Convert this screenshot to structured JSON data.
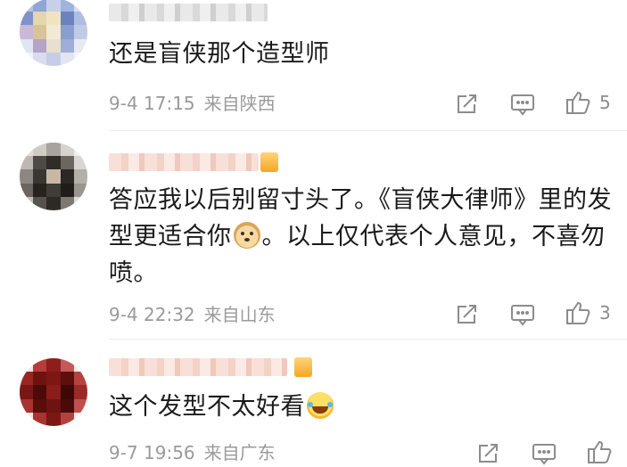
{
  "comments": [
    {
      "text": "还是盲侠那个造型师",
      "text_emoji": "",
      "text_after": "",
      "date": "9-4 17:15",
      "location": "来自陕西",
      "likes": "5"
    },
    {
      "text": "答应我以后别留寸头了。《盲侠大律师》里的发型更适合你",
      "text_emoji": "doge-emoji",
      "text_after": "。以上仅代表个人意见，不喜勿喷。",
      "date": "9-4 22:32",
      "location": "来自山东",
      "likes": "3"
    },
    {
      "text": "这个发型不太好看",
      "text_emoji": "laughing-tears-emoji",
      "text_after": "",
      "date": "9-7 19:56",
      "location": "来自广东",
      "likes": ""
    }
  ],
  "icons": {
    "share": "share-icon",
    "reply": "comment-icon",
    "like": "thumbs-up-icon"
  },
  "colors": {
    "meta_text": "#9a9a9a",
    "icon": "#8c8c8c",
    "divider": "#ececec"
  }
}
